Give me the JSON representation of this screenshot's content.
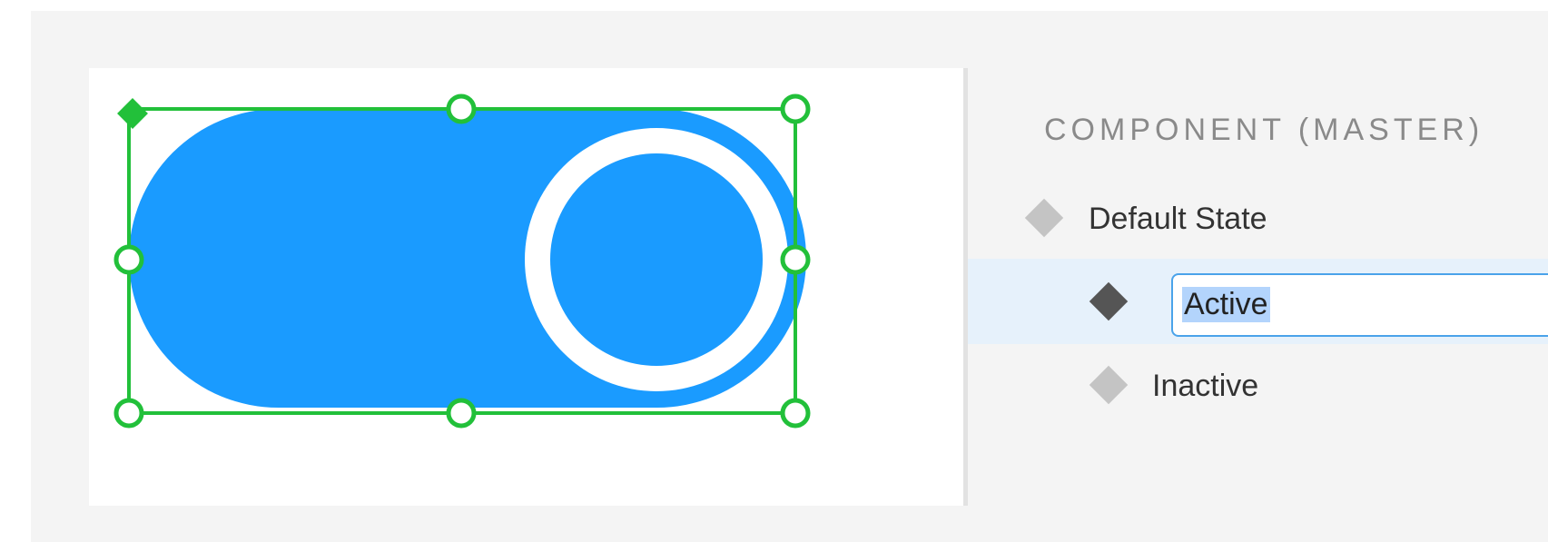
{
  "colors": {
    "toggle_fill": "#1a9bff",
    "selection_handles": "#22c03a",
    "knob_ring": "#ffffff",
    "panel_background": "#f4f4f4",
    "selected_row": "#e6f1fb",
    "text_highlight": "#b3d4fc"
  },
  "canvas": {
    "artwork": "toggle-switch-on",
    "selected": true
  },
  "panel": {
    "section_title": "COMPONENT (MASTER)",
    "states": [
      {
        "label": "Default State",
        "icon": "diamond-light-icon",
        "selected": false
      },
      {
        "label": "Active",
        "icon": "diamond-dark-icon",
        "selected": true,
        "editing": true
      },
      {
        "label": "Inactive",
        "icon": "diamond-light-icon",
        "selected": false
      }
    ]
  }
}
